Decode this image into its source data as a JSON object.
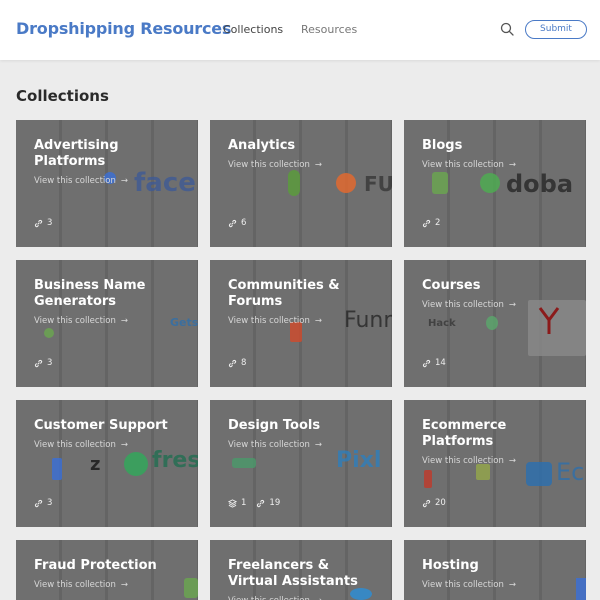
{
  "header": {
    "brand": "Dropshipping Resources",
    "nav": [
      "Collections",
      "Resources"
    ],
    "submit_label": "Submit"
  },
  "section_title": "Collections",
  "view_label": "View this collection",
  "arrow": "→",
  "cards": [
    {
      "title": "Advertising Platforms",
      "count": "3",
      "logo": "faceb"
    },
    {
      "title": "Analytics",
      "count": "6",
      "logo": "FU"
    },
    {
      "title": "Blogs",
      "count": "2",
      "logo": "doba"
    },
    {
      "title": "Business Name Generators",
      "count": "3",
      "logo": "Gets"
    },
    {
      "title": "Communities & Forums",
      "count": "8",
      "logo": "Funn"
    },
    {
      "title": "Courses",
      "count": "14",
      "logo": "Hack"
    },
    {
      "title": "Customer Support",
      "count": "3",
      "logo": "fres"
    },
    {
      "title": "Design Tools",
      "layers": "1",
      "count": "19",
      "logo": "Pixl"
    },
    {
      "title": "Ecommerce Platforms",
      "count": "20",
      "logo": "Ec"
    },
    {
      "title": "Fraud Protection",
      "logo": ""
    },
    {
      "title": "Freelancers & Virtual Assistants",
      "logo": ""
    },
    {
      "title": "Hosting",
      "logo": ""
    }
  ]
}
